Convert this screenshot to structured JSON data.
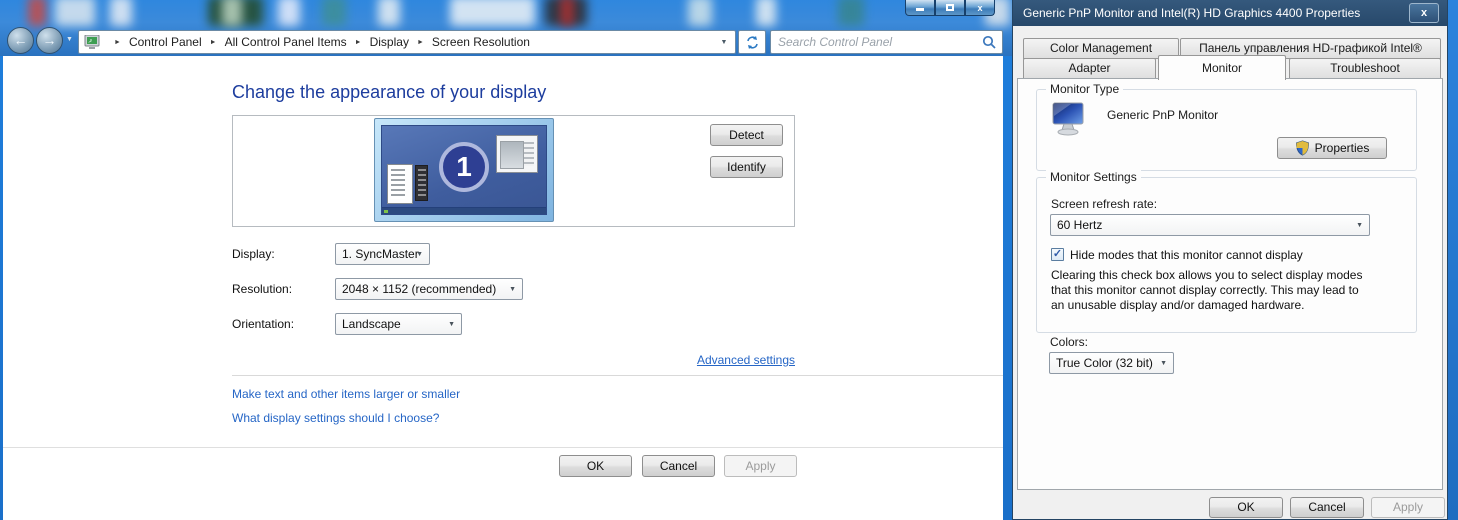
{
  "colors": {
    "desktop_blue": "#1f7fdd",
    "dialog_titlebar": "#2b4e70",
    "heading_blue": "#1d3d9e",
    "link_blue": "#2666c6"
  },
  "icons": {
    "back_arrow": "←",
    "forward_arrow": "→",
    "separator": "►",
    "dropdown": "▼",
    "check": "✓",
    "close_glyph": "x"
  },
  "left_window": {
    "breadcrumb": {
      "items": [
        "Control Panel",
        "All Control Panel Items",
        "Display",
        "Screen Resolution"
      ]
    },
    "search": {
      "placeholder": "Search Control Panel"
    },
    "page": {
      "title": "Change the appearance of your display",
      "monitor_number": "1",
      "detect_label": "Detect",
      "identify_label": "Identify",
      "fields": [
        {
          "label": "Display:",
          "value": "1. SyncMaster"
        },
        {
          "label": "Resolution:",
          "value": "2048 × 1152 (recommended)"
        },
        {
          "label": "Orientation:",
          "value": "Landscape"
        }
      ],
      "advanced_settings_label": "Advanced settings",
      "links": [
        "Make text and other items larger or smaller",
        "What display settings should I choose?"
      ],
      "buttons": {
        "ok": "OK",
        "cancel": "Cancel",
        "apply": "Apply"
      }
    }
  },
  "dialog": {
    "title": "Generic PnP Monitor and Intel(R) HD Graphics 4400 Properties",
    "tabs_row1": [
      "Color Management",
      "Панель управления HD-графикой Intel®"
    ],
    "tabs_row2": [
      "Adapter",
      "Monitor",
      "Troubleshoot"
    ],
    "active_tab": "Monitor",
    "monitor_type": {
      "group_label": "Monitor Type",
      "monitor_name": "Generic PnP Monitor",
      "properties_label": "Properties"
    },
    "monitor_settings": {
      "group_label": "Monitor Settings",
      "refresh_label": "Screen refresh rate:",
      "refresh_value": "60 Hertz",
      "hide_modes_label": "Hide modes that this monitor cannot display",
      "hide_modes_checked": true,
      "description": "Clearing this check box allows you to select display modes that this monitor cannot display correctly. This may lead to an unusable display and/or damaged hardware."
    },
    "colors_label": "Colors:",
    "colors_value": "True Color (32 bit)",
    "buttons": {
      "ok": "OK",
      "cancel": "Cancel",
      "apply": "Apply"
    }
  }
}
